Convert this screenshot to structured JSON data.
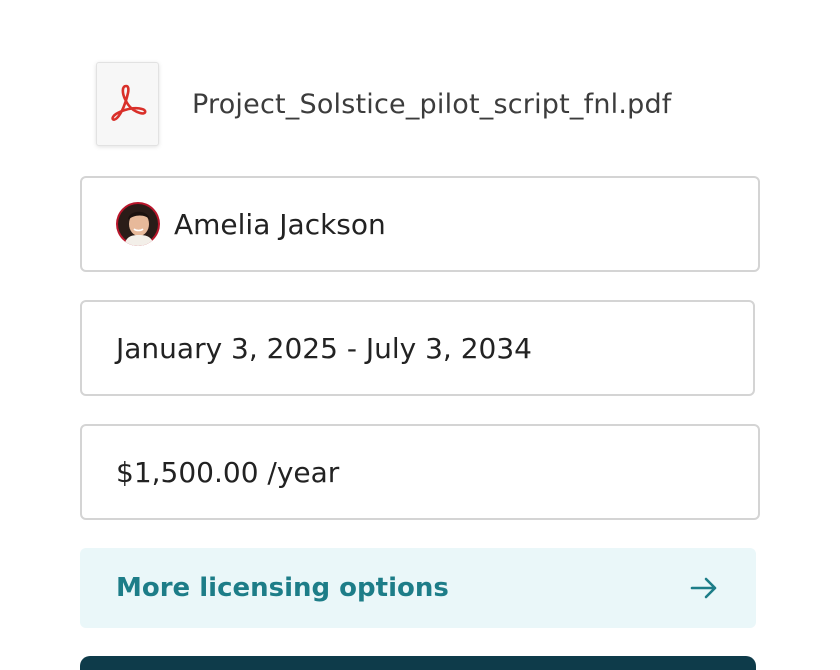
{
  "file": {
    "name": "Project_Solstice_pilot_script_fnl.pdf",
    "icon": "pdf-icon",
    "icon_color": "#d9302a"
  },
  "licensee": {
    "name": "Amelia Jackson",
    "avatar": "avatar"
  },
  "term": {
    "value": "January 3, 2025 - July 3, 2034"
  },
  "price": {
    "value": "$1,500.00 /year"
  },
  "more_options": {
    "label": "More licensing options",
    "icon": "arrow-right-icon",
    "color": "#1d7d88",
    "background": "#eaf7f9"
  },
  "primary_button": {
    "color": "#0e3b4a"
  }
}
